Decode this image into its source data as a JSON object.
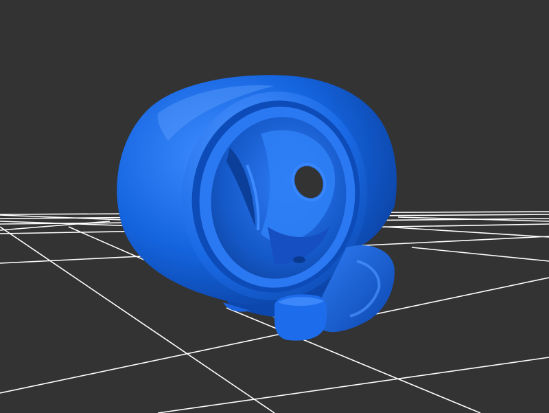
{
  "viewer": {
    "background_color": "#333333",
    "grid_color": "#ffffff",
    "model_color": "#1565e0",
    "model_highlight_color": "#3f8cff",
    "model_shadow_color": "#0a3f9e",
    "grid_visible": true,
    "model": "skull-cutaway-mesh"
  }
}
